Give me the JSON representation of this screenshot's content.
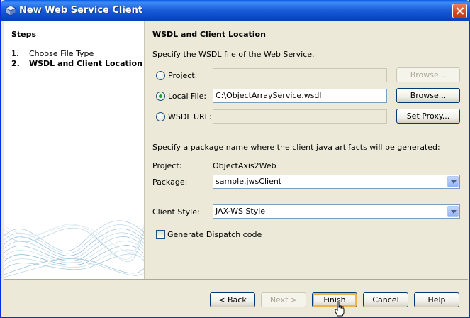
{
  "window": {
    "title": "New Web Service Client"
  },
  "steps": {
    "title": "Steps",
    "items": [
      {
        "num": "1.",
        "label": "Choose File Type"
      },
      {
        "num": "2.",
        "label": "WSDL and Client Location"
      }
    ]
  },
  "section": {
    "title": "WSDL and Client Location",
    "intro": "Specify the WSDL file of the Web Service.",
    "project_radio_label": "Project:",
    "project_value": "",
    "localfile_radio_label": "Local File:",
    "localfile_value": "C:\\ObjectArrayService.wsdl",
    "wsdlurl_radio_label": "WSDL URL:",
    "wsdlurl_value": "",
    "browse_disabled_label": "Browse...",
    "browse_label": "Browse...",
    "set_proxy_label": "Set Proxy...",
    "package_intro": "Specify a package name where the client java artifacts will be generated:",
    "project_label": "Project:",
    "project_name": "ObjectAxis2Web",
    "package_label": "Package:",
    "package_value": "sample.jwsClient",
    "client_style_label": "Client Style:",
    "client_style_value": "JAX-WS Style",
    "dispatch_label": "Generate Dispatch code",
    "selected_source": "Local File",
    "dispatch_checked": false
  },
  "buttons": {
    "back": "< Back",
    "next": "Next >",
    "finish": "Finish",
    "cancel": "Cancel",
    "help": "Help"
  }
}
